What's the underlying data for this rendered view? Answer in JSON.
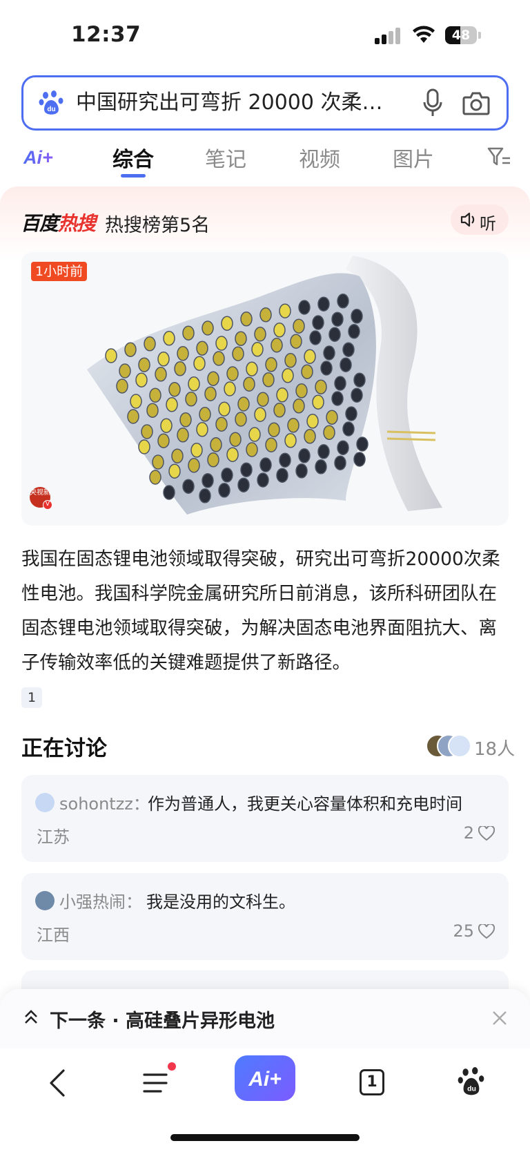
{
  "status_bar": {
    "time": "12:37",
    "battery_level": "48",
    "battery_fraction": 0.48
  },
  "search": {
    "query": "中国研究出可弯折 20000 次柔…",
    "logo_icon": "baidu-paw-icon",
    "voice_icon": "microphone-icon",
    "image_search_icon": "camera-icon",
    "accent": "#4e6ef2"
  },
  "tabs": {
    "ai_label": "Ai+",
    "items": [
      {
        "label": "综合",
        "active": true
      },
      {
        "label": "笔记",
        "active": false
      },
      {
        "label": "视频",
        "active": false
      },
      {
        "label": "图片",
        "active": false
      }
    ],
    "filter_icon": "filter-icon"
  },
  "hot_card": {
    "brand_prefix": "百度",
    "brand_suffix": "热搜",
    "rank_text": "热搜榜第5名",
    "listen_label": "听",
    "image_time": "1小时前",
    "source_badge": "央视新",
    "summary": "我国在固态锂电池领域取得突破，研究出可弯折20000次柔性电池。我国科学院金属研究所日前消息，该所科研团队在固态锂电池领域取得突破，为解决固态电池界面阻抗大、离子传输效率低的关键难题提供了新路径。",
    "reference_number": "1"
  },
  "discussion": {
    "title": "正在讨论",
    "people_count": "18人",
    "comments": [
      {
        "user": "sohontzz：",
        "text": "作为普通人，我更关心容量体积和充电时间",
        "location": "江苏",
        "likes": "2"
      },
      {
        "user": "小强热闹：",
        "text": "我是没用的文科生。",
        "location": "江西",
        "likes": "25"
      }
    ]
  },
  "next_bar": {
    "text": "下一条 · 高硅叠片异形电池"
  },
  "bottom_nav": {
    "ai_label": "Ai+",
    "tab_count": "1",
    "items": [
      "back-icon",
      "menu-icon",
      "ai-button",
      "tabs-icon",
      "baidu-home-icon"
    ]
  }
}
